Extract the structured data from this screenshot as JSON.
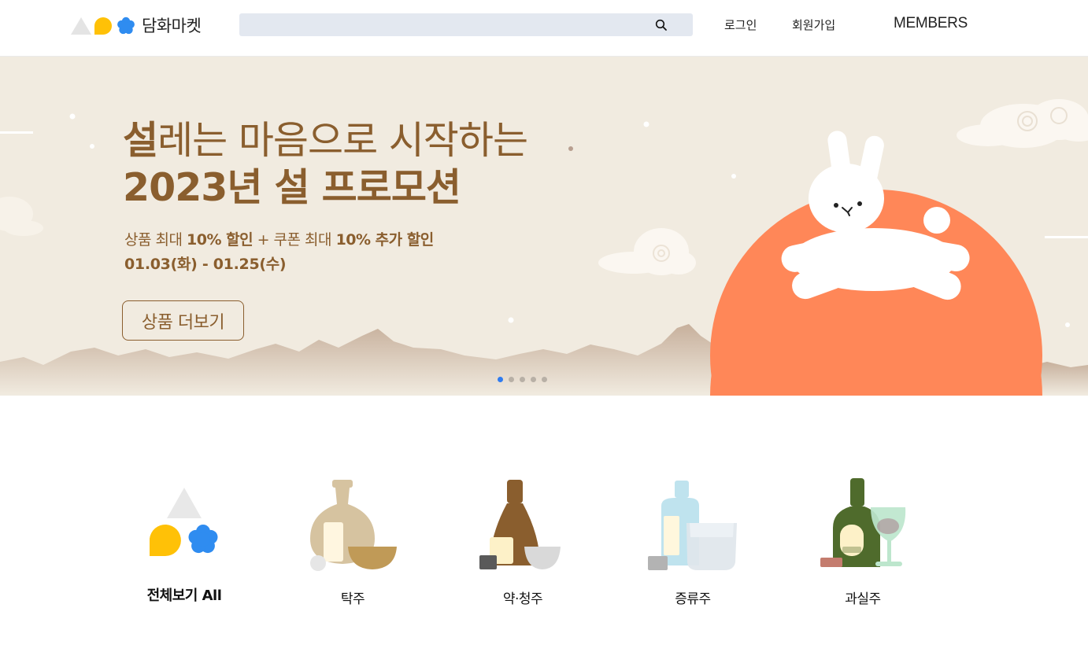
{
  "header": {
    "logo_text": "담화마켓",
    "search_placeholder": "",
    "login": "로그인",
    "signup": "회원가입",
    "members": "MEMBERS"
  },
  "banner": {
    "headline_bold": "설",
    "headline_rest": "레는 마음으로 시작하는",
    "headline_line2": "2023년 설 프로모션",
    "sub_1": "상품 최대 ",
    "sub_2": "10% 할인",
    "sub_3": " + 쿠폰 최대 ",
    "sub_4": "10% 추가 할인",
    "dates": "01.03(화) - 01.25(수)",
    "button": "상품 더보기",
    "slides_total": 5,
    "active_slide": 1
  },
  "categories": [
    {
      "label": "전체보기 All",
      "icon": "all-shapes-icon"
    },
    {
      "label": "탁주",
      "icon": "makgeolli-icon"
    },
    {
      "label": "약·청주",
      "icon": "yakju-bottle-icon"
    },
    {
      "label": "증류주",
      "icon": "soju-bottle-icon"
    },
    {
      "label": "과실주",
      "icon": "wine-bottle-icon"
    }
  ],
  "colors": {
    "banner_bg": "#f1ebe0",
    "brand_brown": "#8a5e2e",
    "sun": "#ff8758",
    "search_bg": "#e3e8f0",
    "dot_active": "#2f7cf0",
    "logo_yellow": "#ffc107",
    "logo_blue": "#2f8cf0"
  }
}
